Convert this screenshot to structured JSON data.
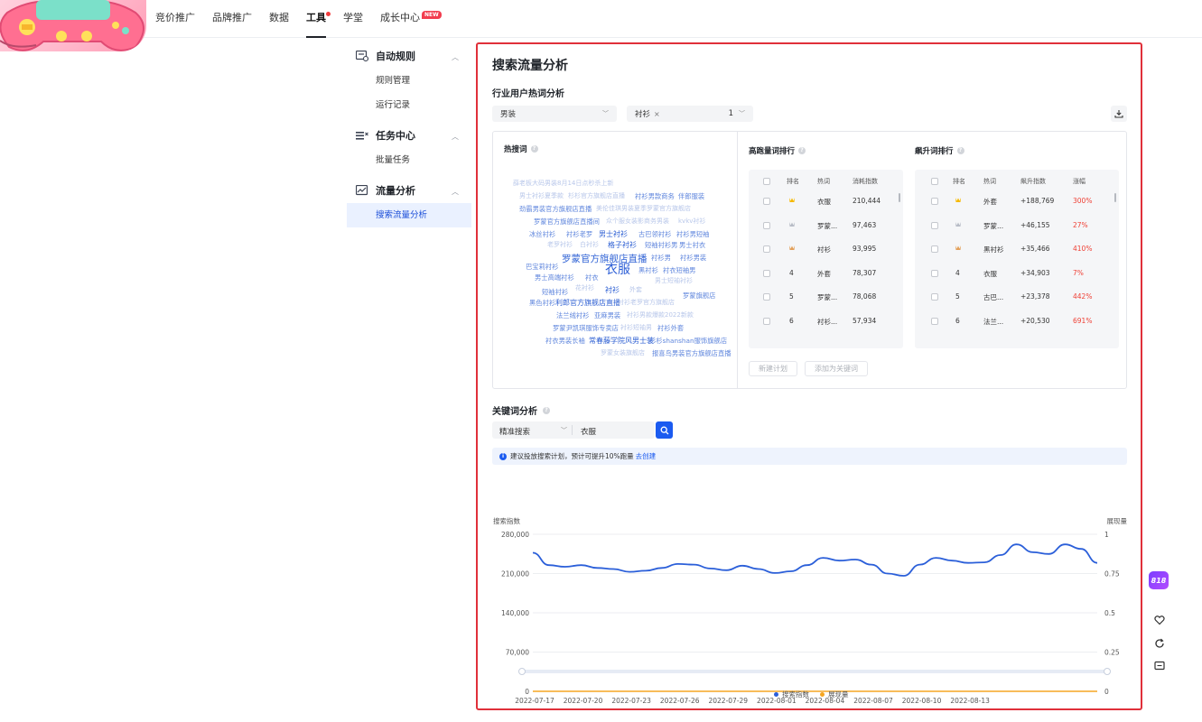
{
  "nav": {
    "items": [
      {
        "label": "竞价推广"
      },
      {
        "label": "品牌推广"
      },
      {
        "label": "数据"
      },
      {
        "label": "工具"
      },
      {
        "label": "学堂"
      },
      {
        "label": "成长中心"
      }
    ],
    "active_index": 3,
    "new_badge": "NEW"
  },
  "sidebar": {
    "groups": [
      {
        "label": "自动规则",
        "icon": "rule-icon",
        "items": [
          "规则管理",
          "运行记录"
        ]
      },
      {
        "label": "任务中心",
        "icon": "task-icon",
        "items": [
          "批量任务"
        ]
      },
      {
        "label": "流量分析",
        "icon": "traffic-icon",
        "items": [
          "搜索流量分析"
        ]
      }
    ],
    "active_item": "搜索流量分析"
  },
  "panel": {
    "title": "搜索流量分析",
    "industry": {
      "title": "行业用户热词分析",
      "industry_select": "男装",
      "keyword_tag": "衬衫",
      "tag_count": "1"
    },
    "hot_words": {
      "title": "热搜词",
      "words": [
        {
          "t": "薛老板大码男装8月14日点秒杀上新",
          "w": 1
        },
        {
          "t": "男士衬衫夏季款",
          "w": 1
        },
        {
          "t": "杉杉官方旗舰店直播",
          "w": 1
        },
        {
          "t": "衬衫男款商务",
          "w": 2
        },
        {
          "t": "伴郎服装",
          "w": 2
        },
        {
          "t": "劲霸男装官方旗舰店直播",
          "w": 2
        },
        {
          "t": "美伦佳琪男装夏季罗蒙官方旗舰店",
          "w": 1
        },
        {
          "t": "罗蒙官方旗舰店直播间",
          "w": 2
        },
        {
          "t": "众个服女装影商务男装",
          "w": 1
        },
        {
          "t": "kvkv衬衫",
          "w": 1
        },
        {
          "t": "冰丝衬衫",
          "w": 2
        },
        {
          "t": "衬衫老罗",
          "w": 2
        },
        {
          "t": "男士衬衫",
          "w": 3
        },
        {
          "t": "古巴领衬衫",
          "w": 2
        },
        {
          "t": "衬衫男短袖",
          "w": 2
        },
        {
          "t": "老罗衬衫",
          "w": 1
        },
        {
          "t": "白衬衫",
          "w": 1
        },
        {
          "t": "格子衬衫",
          "w": 3
        },
        {
          "t": "短袖衬衫男",
          "w": 2
        },
        {
          "t": "男士衬衣",
          "w": 2
        },
        {
          "t": "罗蒙官方旗舰店直播",
          "w": 4
        },
        {
          "t": "衬衫男",
          "w": 2
        },
        {
          "t": "衬衫男装",
          "w": 2
        },
        {
          "t": "巴宝莉衬衫",
          "w": 2
        },
        {
          "t": "衣服",
          "w": 5
        },
        {
          "t": "黑衬衫",
          "w": 2
        },
        {
          "t": "衬衣短袖男",
          "w": 2
        },
        {
          "t": "男士高端衬衫",
          "w": 2
        },
        {
          "t": "衬衣",
          "w": 2
        },
        {
          "t": "男士短袖衬衫",
          "w": 1
        },
        {
          "t": "短袖衬衫",
          "w": 2
        },
        {
          "t": "花衬衫",
          "w": 1
        },
        {
          "t": "衬衫",
          "w": 3
        },
        {
          "t": "外套",
          "w": 1
        },
        {
          "t": "罗蒙旗舰店",
          "w": 2
        },
        {
          "t": "黑色衬衫",
          "w": 2
        },
        {
          "t": "利郎官方旗舰店直播",
          "w": 3
        },
        {
          "t": "衬衫老罗官方旗舰店",
          "w": 1
        },
        {
          "t": "法兰绒衬衫",
          "w": 2
        },
        {
          "t": "亚麻男装",
          "w": 2
        },
        {
          "t": "衬衫男款爆款2022新款",
          "w": 1
        },
        {
          "t": "罗蒙尹凯琪服饰专卖店",
          "w": 2
        },
        {
          "t": "衬衫短袖男",
          "w": 1
        },
        {
          "t": "衬衫外套",
          "w": 2
        },
        {
          "t": "衬衣男装长袖",
          "w": 2
        },
        {
          "t": "常春藤学院风男士装",
          "w": 3
        },
        {
          "t": "杉杉shanshan服饰旗舰店",
          "w": 2
        },
        {
          "t": "罗蒙女装旗舰店",
          "w": 1
        },
        {
          "t": "报喜鸟男装官方旗舰店直播",
          "w": 2
        }
      ]
    },
    "high_traffic": {
      "title": "高跑量词排行",
      "headers": [
        "排名",
        "热词",
        "消耗指数"
      ],
      "rows": [
        {
          "rank": "1",
          "word": "衣服",
          "value": "210,444"
        },
        {
          "rank": "2",
          "word": "罗蒙...",
          "value": "97,463"
        },
        {
          "rank": "3",
          "word": "衬衫",
          "value": "93,995"
        },
        {
          "rank": "4",
          "word": "外套",
          "value": "78,307"
        },
        {
          "rank": "5",
          "word": "罗蒙...",
          "value": "78,068"
        },
        {
          "rank": "6",
          "word": "衬衫...",
          "value": "57,934"
        }
      ],
      "btn_new_plan": "新建计划",
      "btn_add_keyword": "添加为关键词"
    },
    "rising": {
      "title": "飙升词排行",
      "headers": [
        "排名",
        "热词",
        "飙升指数",
        "涨幅"
      ],
      "rows": [
        {
          "rank": "1",
          "word": "外套",
          "value": "+188,769",
          "pct": "300%"
        },
        {
          "rank": "2",
          "word": "罗蒙...",
          "value": "+46,155",
          "pct": "27%"
        },
        {
          "rank": "3",
          "word": "黑衬衫",
          "value": "+35,466",
          "pct": "410%"
        },
        {
          "rank": "4",
          "word": "衣服",
          "value": "+34,903",
          "pct": "7%"
        },
        {
          "rank": "5",
          "word": "古巴...",
          "value": "+23,378",
          "pct": "442%"
        },
        {
          "rank": "6",
          "word": "法兰...",
          "value": "+20,530",
          "pct": "691%"
        }
      ]
    },
    "keyword_analysis": {
      "title": "关键词分析",
      "match_select": "精准搜索",
      "keyword_value": "衣服",
      "notice": "建议投放搜索计划，预计可提升10%跑量",
      "notice_link": "去创建"
    }
  },
  "chart_data": {
    "type": "line",
    "ylabel_left": "搜索指数",
    "ylabel_right": "展现量",
    "y_left_ticks": [
      "280,000",
      "210,000",
      "140,000",
      "70,000",
      "0"
    ],
    "y_right_ticks": [
      "1",
      "0.75",
      "0.5",
      "0.25",
      "0"
    ],
    "ylim_left": [
      0,
      280000
    ],
    "ylim_right": [
      0,
      1
    ],
    "x_ticks": [
      "2022-07-17",
      "2022-07-20",
      "2022-07-23",
      "2022-07-26",
      "2022-07-29",
      "2022-08-01",
      "2022-08-04",
      "2022-08-07",
      "2022-08-10",
      "2022-08-13"
    ],
    "x_start": "2022-07-17",
    "x_end": "2022-08-15",
    "series": [
      {
        "name": "搜索指数",
        "color": "#2b5fd9",
        "axis": "left",
        "values": [
          247000,
          225000,
          222000,
          225000,
          220000,
          218000,
          213000,
          215000,
          220000,
          227000,
          226000,
          219000,
          216000,
          224000,
          218000,
          211000,
          214000,
          225000,
          238000,
          233000,
          235000,
          226000,
          210000,
          206000,
          226000,
          238000,
          233000,
          229000,
          230000,
          243000,
          262000,
          248000,
          245000,
          262000,
          254000,
          229000
        ]
      },
      {
        "name": "展现量",
        "color": "#f5a623",
        "axis": "right",
        "values": [
          0,
          0,
          0,
          0,
          0,
          0,
          0,
          0,
          0,
          0,
          0,
          0,
          0,
          0,
          0,
          0,
          0,
          0,
          0,
          0,
          0,
          0,
          0,
          0,
          0,
          0,
          0,
          0,
          0,
          0,
          0,
          0,
          0,
          0,
          0,
          0
        ]
      }
    ],
    "grid": true,
    "legend_position": "bottom"
  },
  "floating": {
    "promo_badge": "818"
  },
  "colors": {
    "accent": "#1b5bf0",
    "highlight_border": "#e0303a",
    "up_red": "#ef4136"
  }
}
